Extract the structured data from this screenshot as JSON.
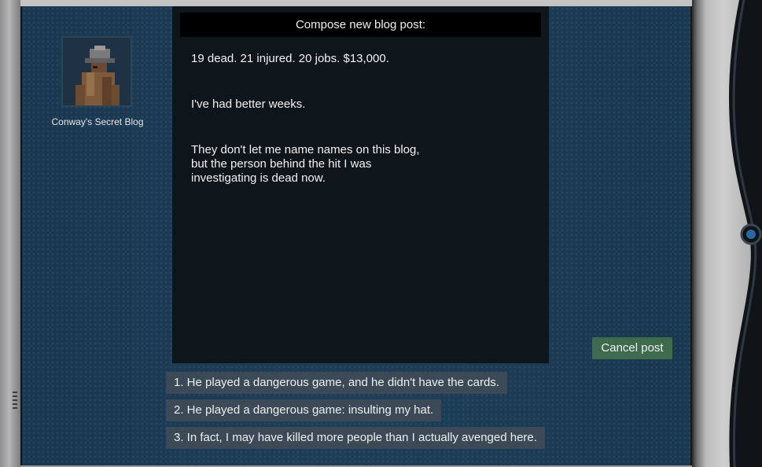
{
  "blog": {
    "name": "Conway's Secret Blog",
    "avatar": "detective-portrait"
  },
  "editor": {
    "header": "Compose new blog post:",
    "paragraphs": [
      "19 dead. 21 injured. 20 jobs. $13,000.",
      "I've had better weeks.",
      "They don't let me name names on this blog,\nbut the person behind the hit I was\ninvestigating is dead now."
    ]
  },
  "actions": {
    "cancel_label": "Cancel post"
  },
  "choices": [
    "1. He played a dangerous game, and he didn't have the cards.",
    "2. He played a dangerous game: insulting my hat.",
    "3. In fact, I may have killed more people than I actually avenged here."
  ],
  "colors": {
    "screen": "#1c3a52",
    "editor_bg": "#0e151b",
    "header_bg": "#000000",
    "choice_bg": "#3b4a56",
    "cancel_bg": "#3e6a4e"
  }
}
